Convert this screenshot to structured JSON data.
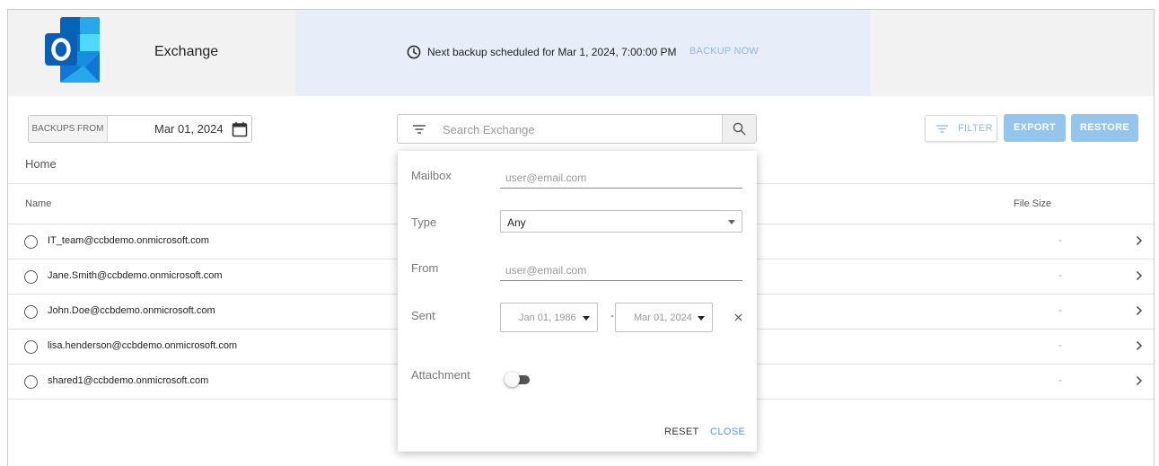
{
  "app": {
    "title": "Exchange"
  },
  "banner": {
    "text": "Next backup scheduled for Mar 1, 2024, 7:00:00 PM",
    "backup_now_label": "BACKUP NOW"
  },
  "toolbar": {
    "backups_from_label": "BACKUPS FROM",
    "backups_from_date": "Mar 01, 2024",
    "search_placeholder": "Search Exchange",
    "filter_label": "FILTER",
    "export_label": "EXPORT",
    "restore_label": "RESTORE"
  },
  "breadcrumb": "Home",
  "table": {
    "columns": {
      "name": "Name",
      "file_size": "File Size"
    },
    "rows": [
      {
        "name": "IT_team@ccbdemo.onmicrosoft.com",
        "size": "-"
      },
      {
        "name": "Jane.Smith@ccbdemo.onmicrosoft.com",
        "size": "-"
      },
      {
        "name": "John.Doe@ccbdemo.onmicrosoft.com",
        "size": "-"
      },
      {
        "name": "lisa.henderson@ccbdemo.onmicrosoft.com",
        "size": "-"
      },
      {
        "name": "shared1@ccbdemo.onmicrosoft.com",
        "size": "-"
      }
    ]
  },
  "filter_panel": {
    "mailbox_label": "Mailbox",
    "mailbox_placeholder": "user@email.com",
    "type_label": "Type",
    "type_value": "Any",
    "from_label": "From",
    "from_placeholder": "user@email.com",
    "sent_label": "Sent",
    "sent_from": "Jan 01, 1986",
    "sent_separator": "-",
    "sent_to": "Mar 01, 2024",
    "attachment_label": "Attachment",
    "attachment_enabled": false,
    "reset_label": "RESET",
    "close_label": "CLOSE"
  },
  "colors": {
    "accent": "#4b9bdc",
    "primary_button": "#94c5ec",
    "banner_bg": "#e8eef9",
    "header_bg": "#f2f2f2"
  },
  "icons": [
    "outlook-logo",
    "clock-icon",
    "calendar-icon",
    "filter-lines-icon",
    "search-icon",
    "chevron-right-icon",
    "clear-icon"
  ]
}
